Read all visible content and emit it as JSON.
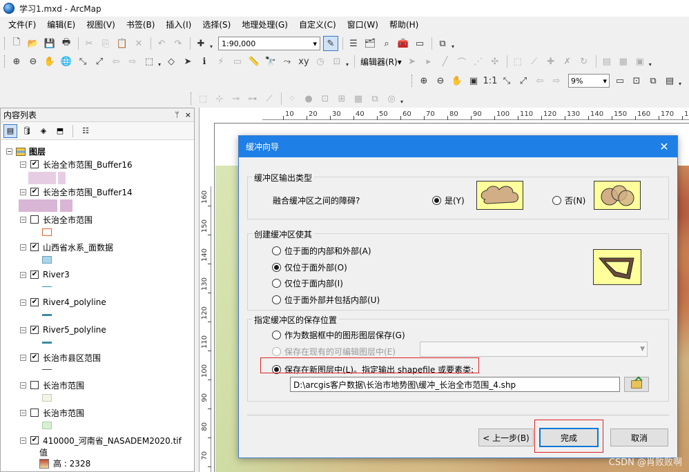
{
  "window": {
    "title": "学习1.mxd - ArcMap"
  },
  "menu": [
    "文件(F)",
    "编辑(E)",
    "视图(V)",
    "书签(B)",
    "插入(I)",
    "选择(S)",
    "地理处理(G)",
    "自定义(C)",
    "窗口(W)",
    "帮助(H)"
  ],
  "toolbar": {
    "scale_value": "1:90,000",
    "editor_label": "编辑器(R)▾",
    "zoom_value": "9%"
  },
  "toc": {
    "title": "内容列表",
    "pin_glyph": "ᛘ",
    "close_glyph": "×",
    "root_label": "图层",
    "layers": [
      {
        "name": "长治全市范围_Buffer16",
        "checked": true,
        "symbol_color": "#e7cde4",
        "symbol": "buffer"
      },
      {
        "name": "长治全市范围_Buffer14",
        "checked": true,
        "symbol_color": "#d9b6d5",
        "symbol": "buffer"
      },
      {
        "name": "长治全市范围",
        "checked": false,
        "symbol_color": "#e5622d",
        "symbol": "outline"
      },
      {
        "name": "山西省水系_面数据",
        "checked": true,
        "symbol_color": "#a9d6ea",
        "symbol": "fill"
      },
      {
        "name": "River3",
        "checked": true,
        "symbol_color": "#2f8fa6",
        "symbol": "line-thin"
      },
      {
        "name": "River4_polyline",
        "checked": true,
        "symbol_color": "#3d8aa0",
        "symbol": "line"
      },
      {
        "name": "River5_polyline",
        "checked": true,
        "symbol_color": "#3d8aa0",
        "symbol": "line"
      },
      {
        "name": "长治市县区范围",
        "checked": true,
        "symbol_color": "#444444",
        "symbol": "line-thin"
      },
      {
        "name": "长治市范围",
        "checked": false,
        "symbol_color": "#f3f4e6",
        "symbol": "fill"
      },
      {
        "name": "长治市范围",
        "checked": false,
        "symbol_color": "#d7f0d2",
        "symbol": "fill"
      },
      {
        "name": "410000_河南省_NASADEM2020.tif",
        "checked": true,
        "symbol_color": "",
        "symbol": "raster"
      }
    ],
    "raster_value_label": "值",
    "raster_high_label": "高 : 2328"
  },
  "ruler": {
    "h_labels": [
      "10",
      "20",
      "30",
      "40",
      "50",
      "60",
      "70",
      "80",
      "90",
      "100",
      "110",
      "120",
      "130",
      "140",
      "150",
      "160",
      "170",
      "180"
    ],
    "v_labels": [
      "160",
      "150",
      "140",
      "130",
      "120",
      "110",
      "100",
      "90",
      "80",
      "70"
    ]
  },
  "dialog": {
    "title": "缓冲向导",
    "group1": {
      "legend": "缓冲区输出类型",
      "question": "融合缓冲区之间的障碍?",
      "yes_label": "是(Y)",
      "no_label": "否(N)",
      "selected": "yes"
    },
    "group2": {
      "legend": "创建缓冲区使其",
      "options": [
        "位于面的内部和外部(A)",
        "仅位于面外部(O)",
        "仅位于面内部(I)",
        "位于面外部并包括内部(U)"
      ],
      "selected_index": 1
    },
    "group3": {
      "legend": "指定缓冲区的保存位置",
      "opt_graphics": "作为数据框中的图形图层保存(G)",
      "opt_existing": "保存在现有的可编辑图层中(E)",
      "opt_new": "保存在新图层中(L)。指定输出 shapefile 或要素类:",
      "selected": "new",
      "path_value": "D:\\arcgis客户数据\\长治市地势图\\缓冲_长治全市范围_4.shp"
    },
    "buttons": {
      "back": "< 上一步(B)",
      "finish": "完成",
      "cancel": "取消"
    }
  },
  "watermark": "CSDN @肖败败啊"
}
